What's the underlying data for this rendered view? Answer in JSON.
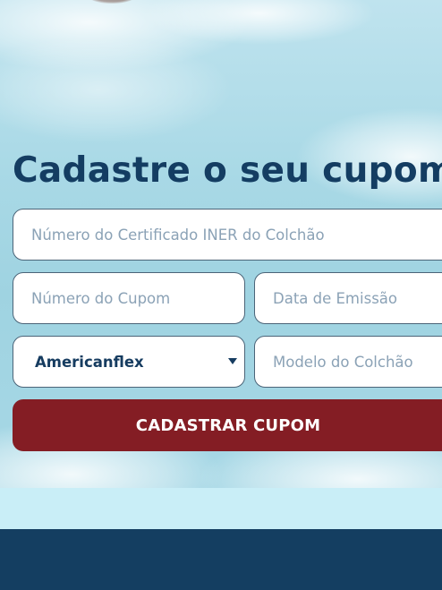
{
  "form": {
    "title": "Cadastre o seu cupom",
    "certificate_placeholder": "Número do Certificado INER do Colchão",
    "coupon_placeholder": "Número do Cupom",
    "date_placeholder": "Data de Emissão",
    "brand_selected": "Americanflex",
    "model_placeholder": "Modelo do Colchão",
    "submit_label": "CADASTRAR CUPOM"
  },
  "colors": {
    "title": "#143d62",
    "button": "#841d24",
    "footer": "#143e61",
    "sky": "#a9d9e6"
  }
}
